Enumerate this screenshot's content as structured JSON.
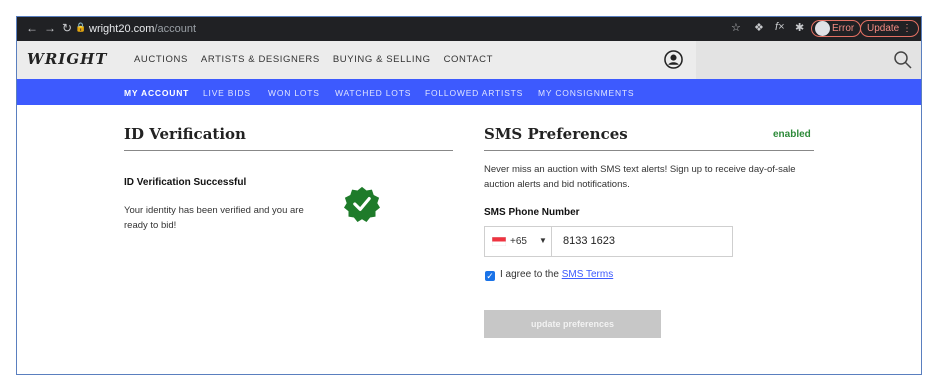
{
  "browser": {
    "url_host": "wright20.com",
    "url_path": "/account",
    "error_label": "Error",
    "update_label": "Update"
  },
  "header": {
    "logo": "WRIGHT",
    "menu": [
      "AUCTIONS",
      "ARTISTS & DESIGNERS",
      "BUYING & SELLING",
      "CONTACT"
    ]
  },
  "subnav": {
    "items": [
      "MY ACCOUNT",
      "LIVE BIDS",
      "WON LOTS",
      "WATCHED LOTS",
      "FOLLOWED ARTISTS",
      "MY CONSIGNMENTS"
    ]
  },
  "id_verification": {
    "title": "ID Verification",
    "status_title": "ID Verification Successful",
    "message_line1": "Your identity has been verified and you are",
    "message_line2": "ready to bid!"
  },
  "sms": {
    "title": "SMS Preferences",
    "status": "enabled",
    "desc_line1": "Never miss an auction with SMS text alerts! Sign up to receive day-of-sale",
    "desc_line2": "auction alerts and bid notifications.",
    "phone_label": "SMS Phone Number",
    "country_code": "+65",
    "phone_value": "8133 1623",
    "agree_text": "I agree to the",
    "terms_link": "SMS Terms",
    "button_label": "update preferences",
    "agree_checked": true
  },
  "colors": {
    "accent": "#3d5afe",
    "success": "#2e8b3a",
    "badge": "#1e7b2a"
  }
}
